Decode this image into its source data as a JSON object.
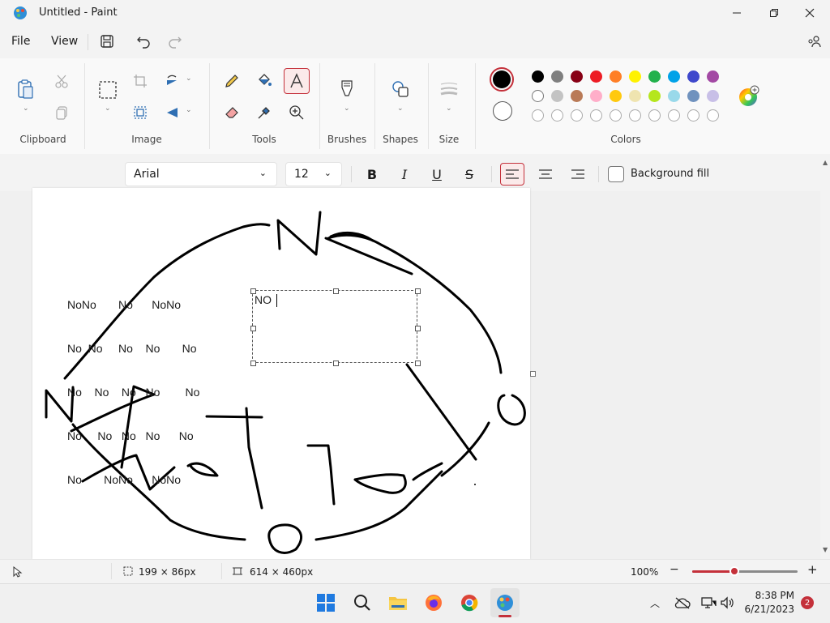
{
  "window": {
    "title": "Untitled - Paint"
  },
  "menu": {
    "file": "File",
    "view": "View"
  },
  "ribbon": {
    "groups": {
      "clipboard": "Clipboard",
      "image": "Image",
      "tools": "Tools",
      "brushes": "Brushes",
      "shapes": "Shapes",
      "size": "Size",
      "colors": "Colors"
    },
    "palette_row1": [
      "#000000",
      "#7f7f7f",
      "#880015",
      "#ed1c24",
      "#ff7f27",
      "#fff200",
      "#22b14c",
      "#00a2e8",
      "#3f48cc",
      "#a349a4"
    ],
    "palette_row2": [
      "#ffffff",
      "#c3c3c3",
      "#b97a57",
      "#ffaec9",
      "#ffc90e",
      "#efe4b0",
      "#b5e61d",
      "#99d9ea",
      "#7092be",
      "#c8bfe7"
    ]
  },
  "text_toolbar": {
    "font": "Arial",
    "size": "12",
    "bold": "B",
    "italic": "I",
    "underline": "U",
    "strike": "S",
    "background_fill": "Background fill"
  },
  "canvas_text": {
    "lines": [
      "NoNo       No      NoNo",
      "No  No     No    No       No",
      "No    No    No   No        No",
      "No     No   No   No      No",
      "No       NoNo      NoNo"
    ],
    "textbox": "NO"
  },
  "status": {
    "selection_size": "199 × 86px",
    "canvas_size": "614 × 460px",
    "zoom": "100%",
    "zoom_fraction": 0.4
  },
  "taskbar": {
    "time": "8:38 PM",
    "date": "6/21/2023",
    "badge": "2"
  }
}
